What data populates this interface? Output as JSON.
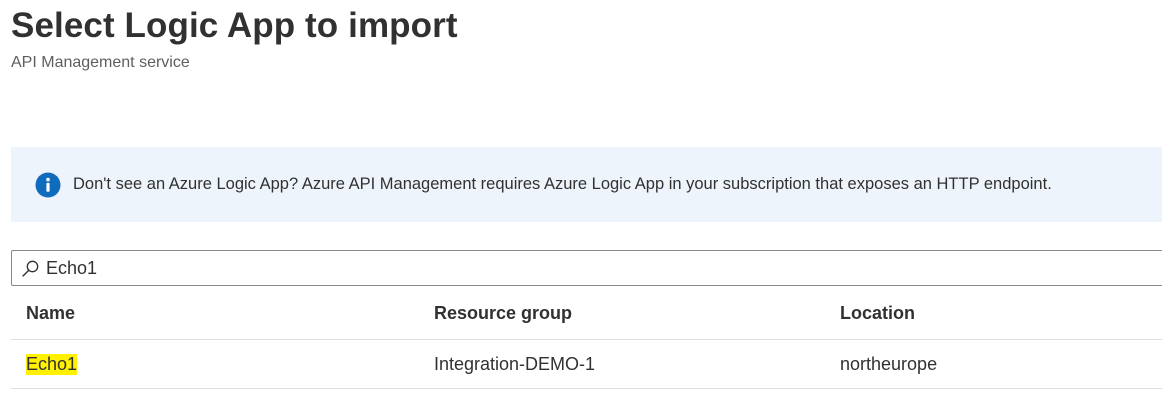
{
  "header": {
    "title": "Select Logic App to import",
    "subtitle": "API Management service"
  },
  "info": {
    "icon": "info-icon",
    "text": "Don't see an Azure Logic App? Azure API Management requires Azure Logic App in your subscription that exposes an HTTP endpoint.",
    "accent_color": "#0f6cbd",
    "background_color": "#eef4fc"
  },
  "search": {
    "icon": "search-icon",
    "value": "Echo1"
  },
  "table": {
    "columns": [
      "Name",
      "Resource group",
      "Location"
    ],
    "rows": [
      {
        "name": "Echo1",
        "resource_group": "Integration-DEMO-1",
        "location": "northeurope"
      }
    ],
    "highlight_color": "#fff100"
  }
}
